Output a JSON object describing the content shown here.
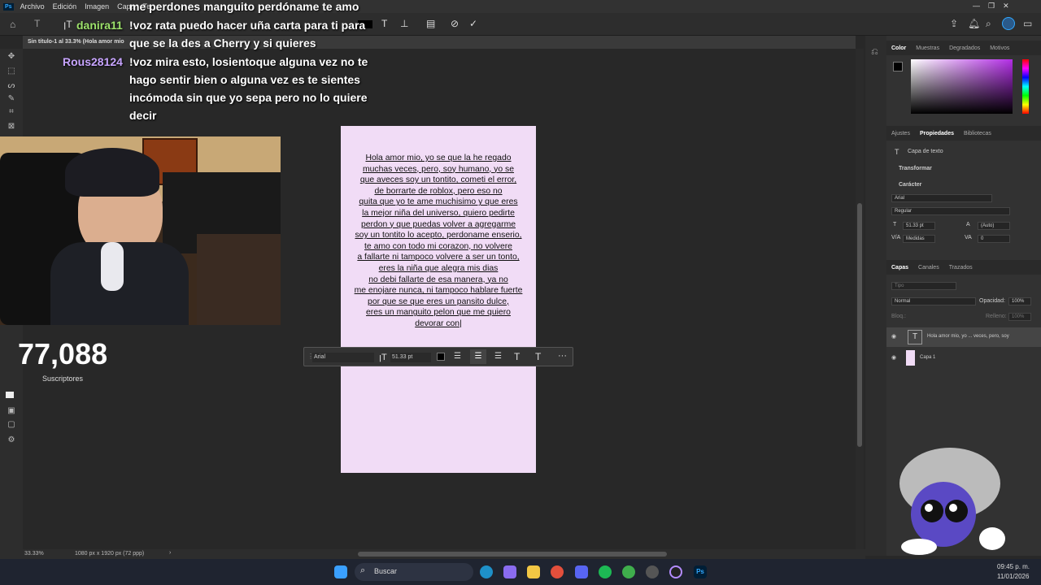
{
  "app": {
    "logo": "Ps",
    "menu": [
      "Archivo",
      "Edición",
      "Imagen",
      "Capa",
      "Te"
    ]
  },
  "document": {
    "tab_title": "Sin título-1 al 33.3% (Hola amor mio",
    "zoom": "33.33%",
    "size_info": "1080 px x 1920 px (72 ppp)"
  },
  "chat": [
    {
      "user": "",
      "text": "me perdones manguito perdóname te amo"
    },
    {
      "user": "danira11",
      "text": "!voz rata puedo hacer uña carta para ti para"
    },
    {
      "user": "",
      "text": "que se la des a Cherry y si quieres"
    },
    {
      "user": "Rous28124",
      "text": "!voz mira esto, losientoque alguna vez no te"
    },
    {
      "user": "",
      "text": "hago sentir bien o alguna vez es te sientes"
    },
    {
      "user": "",
      "text": "incómoda sin que yo sepa pero no lo quiere"
    },
    {
      "user": "",
      "text": "decir"
    }
  ],
  "letter_lines": [
    "Hola amor mio, yo se que la he regado",
    "muchas veces, pero, soy humano, yo se",
    "que aveces soy un tontito, cometi el error,",
    "de borrarte de roblox, pero eso no",
    "quita que yo te ame muchisimo y que eres",
    "la mejor niña del universo, quiero pedirte",
    "perdon y que puedas volver a agregarme",
    "soy un tontito lo acepto, perdoname enserio,",
    "te amo con todo mi corazon, no volvere",
    "a fallarte ni tampoco volvere a ser un tonto,",
    "eres la niña que alegra mis dias",
    "no debi fallarte de esa manera, ya no",
    "me enojare nunca, ni tampoco hablare fuerte",
    "por que se que eres un pansito dulce,",
    "eres un manguito pelon que me quiero",
    "devorar con|"
  ],
  "text_toolbar": {
    "font": "Arial",
    "size": "51.33 pt"
  },
  "subscribers": {
    "count": "77,088",
    "label": "Suscriptores"
  },
  "panels": {
    "color_tabs": [
      "Color",
      "Muestras",
      "Degradados",
      "Motivos"
    ],
    "prop_tabs": [
      "Ajustes",
      "Propiedades",
      "Bibliotecas"
    ],
    "layer_type": "Capa de texto",
    "transform": "Transformar",
    "character": "Carácter",
    "font": "Arial",
    "style": "Regular",
    "size": "51.33 pt",
    "leading": "(Auto)",
    "kerning": "Medidas",
    "tracking": "0",
    "layers_tabs": [
      "Capas",
      "Canales",
      "Trazados"
    ],
    "kind": "Tipo",
    "blend": "Normal",
    "opacity_label": "Opacidad:",
    "opacity": "100%",
    "lock_label": "Bloq.:",
    "fill_label": "Relleno:",
    "fill": "100%",
    "layers": [
      "Hola amor mio, yo ... veces, pero, soy",
      "Capa 1"
    ]
  },
  "taskbar": {
    "search": "Buscar",
    "time": "09:45 p. m.",
    "date": "11/01/2026"
  },
  "colors": {
    "accent": "#31a8ff",
    "doc_bg": "#f1dcf6",
    "username_green": "#9de26b",
    "username_purple": "#c7a4ff"
  }
}
